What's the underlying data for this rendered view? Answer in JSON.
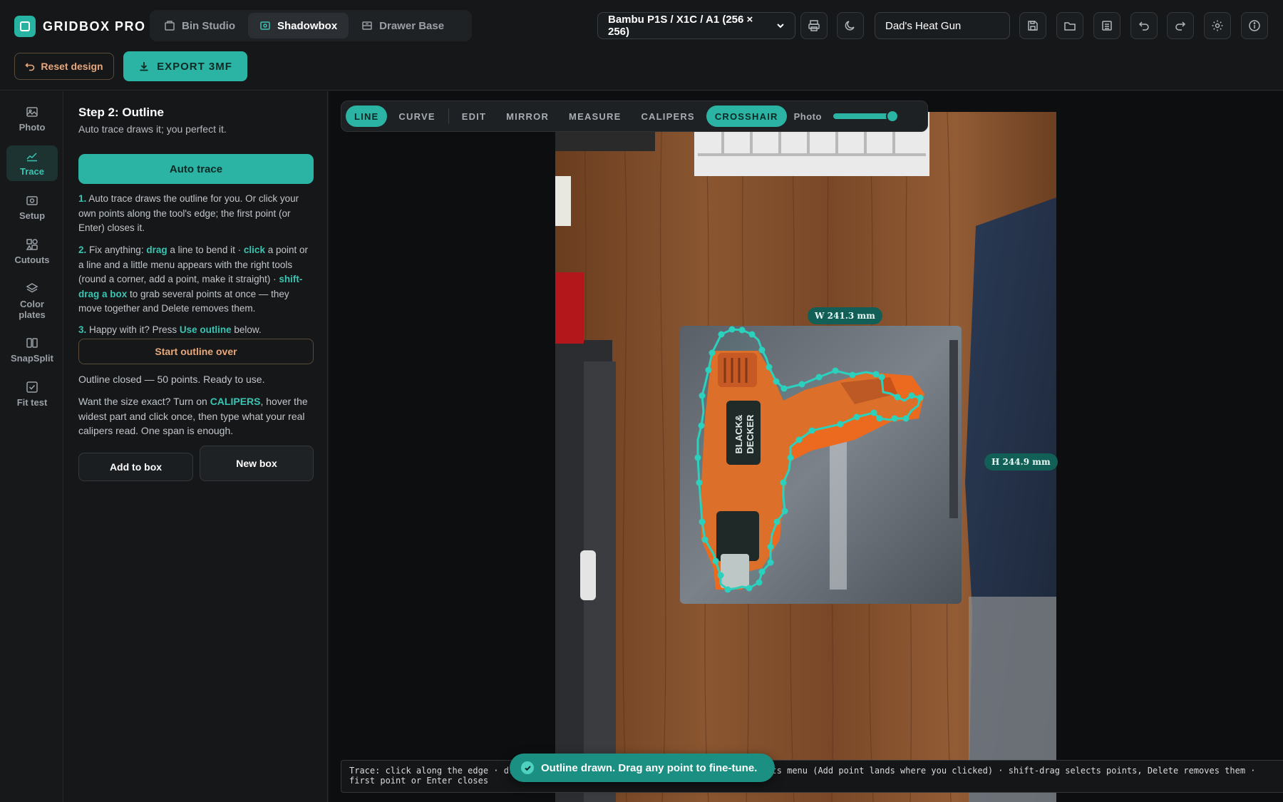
{
  "app": {
    "name": "GRIDBOX PRO",
    "modes": [
      {
        "label": "Bin Studio",
        "icon": "bin-icon",
        "active": false
      },
      {
        "label": "Shadowbox",
        "icon": "shadowbox-icon",
        "active": true
      },
      {
        "label": "Drawer Base",
        "icon": "drawer-icon",
        "active": false
      }
    ],
    "printer": "Bambu P1S / X1C / A1 (256 × 256)",
    "project_name": "Dad's Heat Gun"
  },
  "actions": {
    "reset": "Reset design",
    "export": "EXPORT 3MF"
  },
  "rail": [
    {
      "label": "Photo",
      "icon": "image-icon",
      "active": false
    },
    {
      "label": "Trace",
      "icon": "trace-line-icon",
      "active": true
    },
    {
      "label": "Setup",
      "icon": "camera-icon",
      "active": false
    },
    {
      "label": "Cutouts",
      "icon": "shapes-icon",
      "active": false
    },
    {
      "label": "Color plates",
      "icon": "layers-icon",
      "active": false
    },
    {
      "label": "SnapSplit",
      "icon": "split-icon",
      "active": false
    },
    {
      "label": "Fit test",
      "icon": "checkbox-icon",
      "active": false
    }
  ],
  "panel": {
    "title": "Step 2: Outline",
    "subtitle": "Auto trace draws it; you perfect it.",
    "auto_trace": "Auto trace",
    "steps": {
      "s1_num": "1.",
      "s1_text": "Auto trace draws the outline for you. Or click your own points along the tool's edge; the first point (or Enter) closes it.",
      "s2_num": "2.",
      "s2_a": "Fix anything: ",
      "s2_drag": "drag",
      "s2_b": " a line to bend it · ",
      "s2_click": "click",
      "s2_c": " a point or a line and a little menu appears with the right tools (round a corner, add a point, make it straight) · ",
      "s2_shift": "shift-drag a box",
      "s2_d": " to grab several points at once — they move together and Delete removes them.",
      "s3_num": "3.",
      "s3_a": "Happy with it? Press ",
      "s3_use": "Use outline",
      "s3_b": " below."
    },
    "restart": "Start outline over",
    "status": "Outline closed — 50 points. Ready to use.",
    "hint_a": "Want the size exact? Turn on ",
    "hint_calipers": "CALIPERS",
    "hint_b": ", hover the widest part and click once, then type what your real calipers read. One span is enough.",
    "add_to_box": "Add to box",
    "new_box": "New box"
  },
  "toolbar": {
    "tools": [
      "LINE",
      "CURVE",
      "EDIT",
      "MIRROR",
      "MEASURE",
      "CALIPERS",
      "CROSSHAIR"
    ],
    "active": [
      "LINE",
      "CROSSHAIR"
    ],
    "photo_label": "Photo",
    "photo_opacity": 0.9
  },
  "measurements": {
    "width": "W 241.3 mm",
    "height": "H 244.9 mm"
  },
  "photo_text": {
    "brand_line1": "BLACK&",
    "brand_line2": "DECKER"
  },
  "help": {
    "text": "Trace: click along the edge · drag a line to bend it · click a point or line for its menu (Add point lands where you clicked) · shift-drag selects points, Delete removes them · first point or Enter closes"
  },
  "toast": {
    "text": "Outline drawn. Drag any point to fine-tune."
  },
  "colors": {
    "accent": "#2bb3a3",
    "warning": "#e8a87c",
    "background": "#121416"
  }
}
